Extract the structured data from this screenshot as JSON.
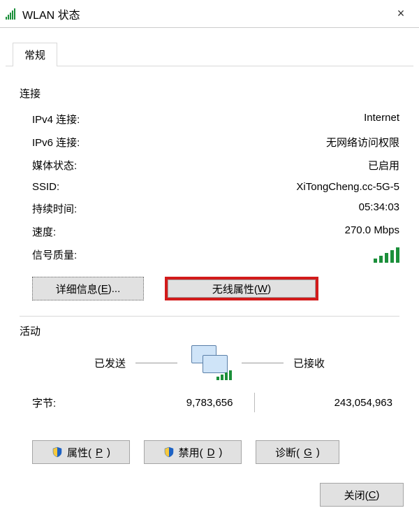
{
  "window": {
    "title": "WLAN 状态",
    "close": "×"
  },
  "tabs": {
    "general": "常规"
  },
  "connection": {
    "section_title": "连接",
    "ipv4_label": "IPv4 连接:",
    "ipv4_value": "Internet",
    "ipv6_label": "IPv6 连接:",
    "ipv6_value": "无网络访问权限",
    "media_label": "媒体状态:",
    "media_value": "已启用",
    "ssid_label": "SSID:",
    "ssid_value": "XiTongCheng.cc-5G-5",
    "duration_label": "持续时间:",
    "duration_value": "05:34:03",
    "speed_label": "速度:",
    "speed_value": "270.0 Mbps",
    "signal_label": "信号质量:"
  },
  "buttons": {
    "details_prefix": "详细信息(",
    "details_hotkey": "E",
    "details_suffix": ")...",
    "wireless_prefix": "无线属性(",
    "wireless_hotkey": "W",
    "wireless_suffix": ")"
  },
  "activity": {
    "section_title": "活动",
    "sent_label": "已发送",
    "recv_label": "已接收",
    "bytes_label": "字节:",
    "bytes_sent": "9,783,656",
    "bytes_recv": "243,054,963"
  },
  "bottom": {
    "props_prefix": "属性(",
    "props_hotkey": "P",
    "props_suffix": ")",
    "disable_prefix": "禁用(",
    "disable_hotkey": "D",
    "disable_suffix": ")",
    "diag_prefix": "诊断(",
    "diag_hotkey": "G",
    "diag_suffix": ")"
  },
  "footer": {
    "close_prefix": "关闭(",
    "close_hotkey": "C",
    "close_suffix": ")"
  }
}
